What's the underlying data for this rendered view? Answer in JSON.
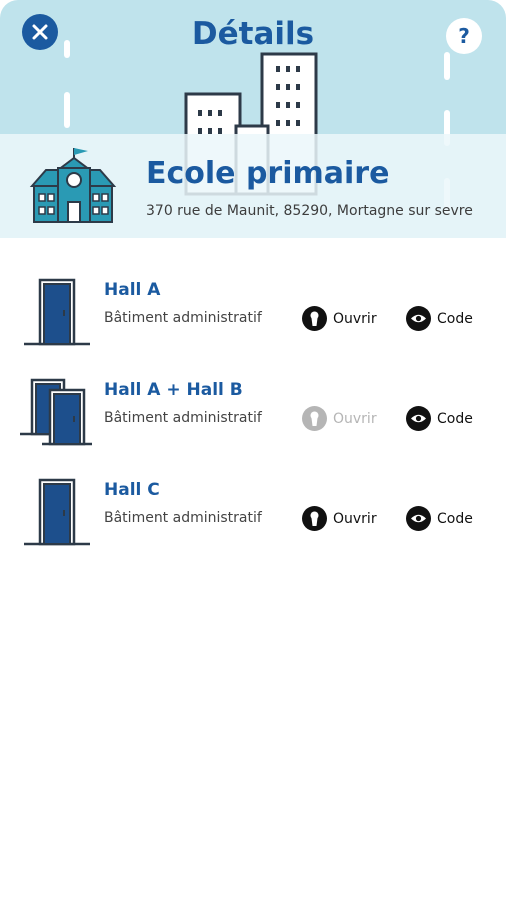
{
  "header": {
    "title": "Détails",
    "help_label": "?",
    "close_icon": "close-icon",
    "colors": {
      "accent": "#1b5aa0",
      "header_bg": "#bfe3ec"
    }
  },
  "place": {
    "name": "Ecole primaire",
    "address": "370 rue de Maunit, 85290, Mortagne sur sevre",
    "icon": "school-icon"
  },
  "items": [
    {
      "title": "Hall A",
      "subtitle": "Bâtiment administratif",
      "open_label": "Ouvrir",
      "open_enabled": true,
      "code_label": "Code",
      "icon": "door-icon"
    },
    {
      "title": "Hall A + Hall B",
      "subtitle": "Bâtiment administratif",
      "open_label": "Ouvrir",
      "open_enabled": false,
      "code_label": "Code",
      "icon": "double-door-icon"
    },
    {
      "title": "Hall C",
      "subtitle": "Bâtiment administratif",
      "open_label": "Ouvrir",
      "open_enabled": true,
      "code_label": "Code",
      "icon": "door-icon"
    }
  ]
}
